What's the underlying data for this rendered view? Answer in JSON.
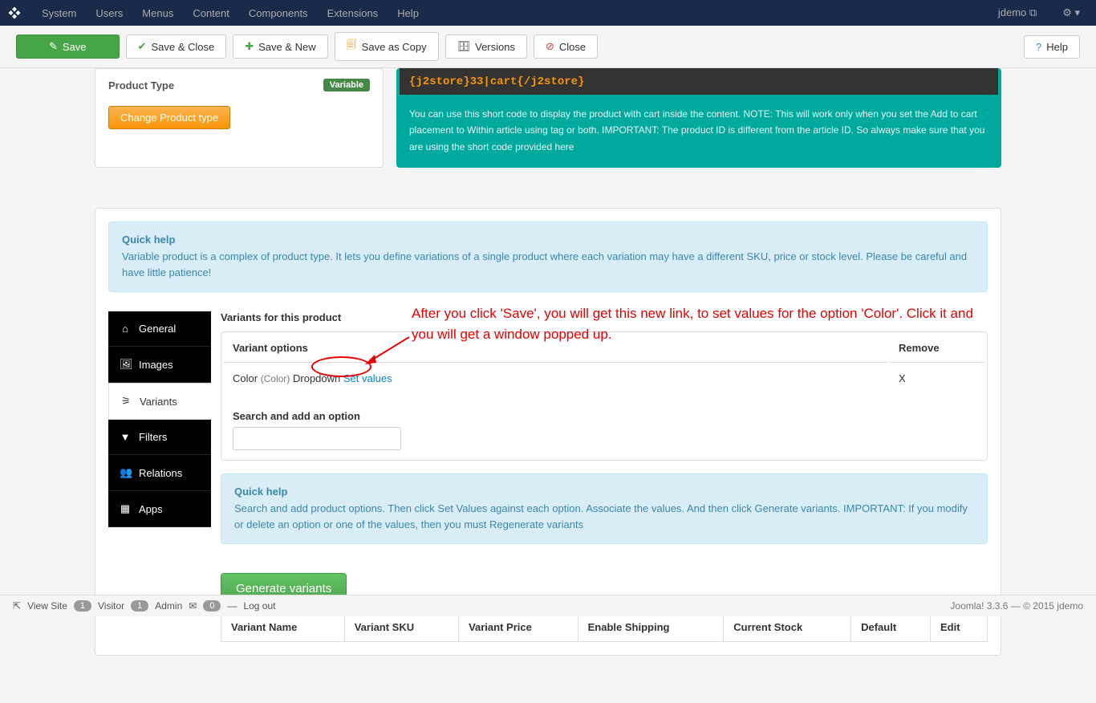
{
  "navbar": {
    "items": [
      "System",
      "Users",
      "Menus",
      "Content",
      "Components",
      "Extensions",
      "Help"
    ],
    "user": "jdemo"
  },
  "toolbar": {
    "save": "Save",
    "save_close": "Save & Close",
    "save_new": "Save & New",
    "save_copy": "Save as Copy",
    "versions": "Versions",
    "close": "Close",
    "help": "Help"
  },
  "left_panel": {
    "label": "Product Type",
    "badge": "Variable",
    "change_btn": "Change Product type"
  },
  "right_panel": {
    "shortcode": "{j2store}33|cart{/j2store}",
    "desc": "You can use this short code to display the product with cart inside the content. NOTE: This will work only when you set the Add to cart placement to Within article using tag or both. IMPORTANT: The product ID is different from the article ID. So always make sure that you are using the short code provided here"
  },
  "quick_help_1": {
    "title": "Quick help",
    "body": "Variable product is a complex of product type. It lets you define variations of a single product where each variation may have a different SKU, price or stock level. Please be careful and have little patience!"
  },
  "side_tabs": {
    "general": "General",
    "images": "Images",
    "variants": "Variants",
    "filters": "Filters",
    "relations": "Relations",
    "apps": "Apps"
  },
  "variants": {
    "title": "Variants for this product",
    "th_options": "Variant options",
    "th_remove": "Remove",
    "row_name": "Color",
    "row_paren": "(Color)",
    "row_type": "Dropdown",
    "set_values": "Set values",
    "remove_x": "X",
    "search_label": "Search and add an option",
    "search_value": ""
  },
  "annotation": "After you click 'Save', you will get this new link, to set values for the option 'Color'. Click it and you will get a window popped up.",
  "quick_help_2": {
    "title": "Quick help",
    "body": "Search and add product options. Then click Set Values against each option. Associate the values. And then click Generate variants. IMPORTANT: If you modify or delete an option or one of the values, then you must Regenerate variants"
  },
  "generate_btn": "Generate variants",
  "var_grid": {
    "cols": [
      "Variant Name",
      "Variant SKU",
      "Variant Price",
      "Enable Shipping",
      "Current Stock",
      "Default",
      "Edit"
    ]
  },
  "footer": {
    "view_site": "View Site",
    "visitor_count": "1",
    "visitor": "Visitor",
    "admin_count": "1",
    "admin": "Admin",
    "mail_count": "0",
    "logout": "Log out",
    "right": "Joomla! 3.3.6  —  © 2015 jdemo"
  }
}
